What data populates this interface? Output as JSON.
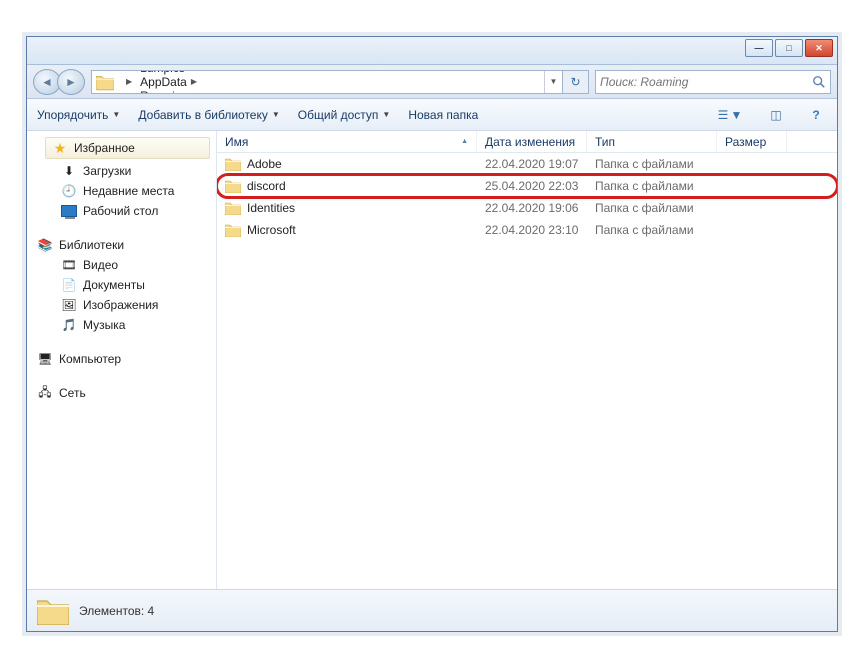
{
  "window": {
    "min_tip": "Свернуть",
    "max_tip": "Развернуть",
    "close_tip": "Закрыть"
  },
  "breadcrumbs": [
    "Lumpics",
    "AppData",
    "Roaming"
  ],
  "search": {
    "placeholder": "Поиск: Roaming"
  },
  "toolbar": {
    "organize": "Упорядочить",
    "include": "Добавить в библиотеку",
    "share": "Общий доступ",
    "newfolder": "Новая папка"
  },
  "columns": {
    "name": "Имя",
    "date": "Дата изменения",
    "type": "Тип",
    "size": "Размер"
  },
  "rows": [
    {
      "name": "Adobe",
      "date": "22.04.2020 19:07",
      "type": "Папка с файлами",
      "highlight": false
    },
    {
      "name": "discord",
      "date": "25.04.2020 22:03",
      "type": "Папка с файлами",
      "highlight": true
    },
    {
      "name": "Identities",
      "date": "22.04.2020 19:06",
      "type": "Папка с файлами",
      "highlight": false
    },
    {
      "name": "Microsoft",
      "date": "22.04.2020 23:10",
      "type": "Папка с файлами",
      "highlight": false
    }
  ],
  "sidebar": {
    "favorites": {
      "label": "Избранное",
      "items": [
        "Загрузки",
        "Недавние места",
        "Рабочий стол"
      ]
    },
    "libraries": {
      "label": "Библиотеки",
      "items": [
        "Видео",
        "Документы",
        "Изображения",
        "Музыка"
      ]
    },
    "computer": {
      "label": "Компьютер"
    },
    "network": {
      "label": "Сеть"
    }
  },
  "status": {
    "text": "Элементов: 4"
  }
}
